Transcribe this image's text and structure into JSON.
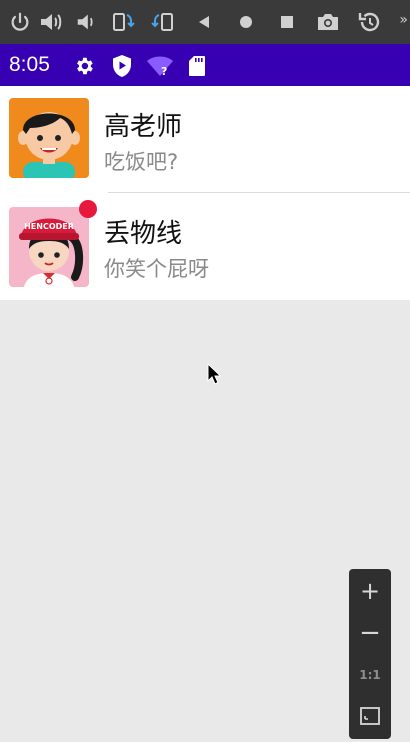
{
  "emulator_toolbar": {
    "icons": [
      "power-icon",
      "volume-up-icon",
      "volume-down-icon",
      "rotate-left-icon",
      "rotate-right-icon",
      "back-icon",
      "home-icon",
      "overview-icon",
      "camera-icon",
      "restore-icon"
    ],
    "more": "»"
  },
  "status_bar": {
    "time": "8:05",
    "color": "#3700b3"
  },
  "conversations": [
    {
      "name": "高老师",
      "message": "吃饭吧?",
      "unread": false
    },
    {
      "name": "丢物线",
      "message": "你笑个屁呀",
      "unread": true,
      "avatar_text": "HENCODER"
    }
  ],
  "zoom_controls": {
    "plus": "+",
    "minus": "−",
    "one_to_one": "1:1"
  },
  "colors": {
    "accent": "#3700b3",
    "badge": "#e8173e",
    "toolbar": "#3a3a3a"
  }
}
